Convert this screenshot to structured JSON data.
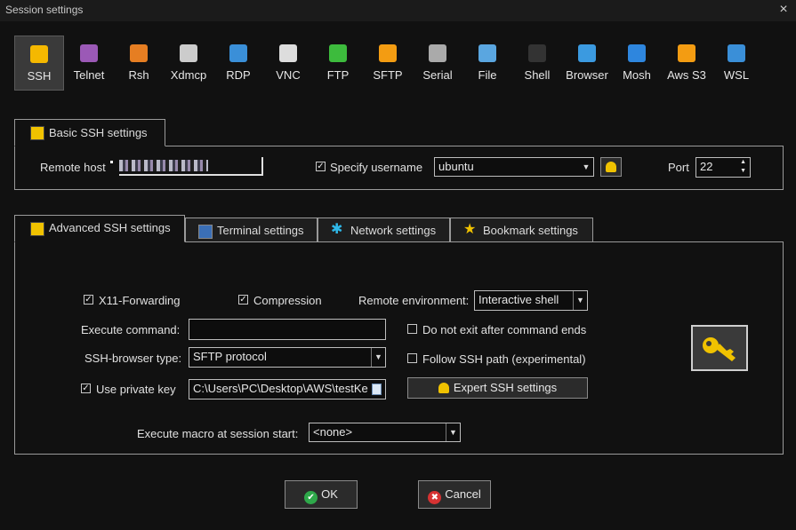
{
  "window": {
    "title": "Session settings",
    "close_icon": "×"
  },
  "protocols": [
    {
      "label": "SSH",
      "icon": "key-icon",
      "color": "#f5b800",
      "active": true
    },
    {
      "label": "Telnet",
      "icon": "telnet-icon",
      "color": "#9b59b6",
      "active": false
    },
    {
      "label": "Rsh",
      "icon": "rsh-icon",
      "color": "#e67e22",
      "active": false
    },
    {
      "label": "Xdmcp",
      "icon": "xdmcp-icon",
      "color": "#cccccc",
      "active": false
    },
    {
      "label": "RDP",
      "icon": "rdp-icon",
      "color": "#3a8fd8",
      "active": false
    },
    {
      "label": "VNC",
      "icon": "vnc-icon",
      "color": "#dddddd",
      "active": false
    },
    {
      "label": "FTP",
      "icon": "ftp-icon",
      "color": "#3dbb3d",
      "active": false
    },
    {
      "label": "SFTP",
      "icon": "sftp-icon",
      "color": "#f39c12",
      "active": false
    },
    {
      "label": "Serial",
      "icon": "serial-icon",
      "color": "#aaaaaa",
      "active": false
    },
    {
      "label": "File",
      "icon": "file-icon",
      "color": "#5aa6e0",
      "active": false
    },
    {
      "label": "Shell",
      "icon": "shell-icon",
      "color": "#333333",
      "active": false
    },
    {
      "label": "Browser",
      "icon": "globe-icon",
      "color": "#3b9ae0",
      "active": false
    },
    {
      "label": "Mosh",
      "icon": "mosh-icon",
      "color": "#2e86de",
      "active": false
    },
    {
      "label": "Aws S3",
      "icon": "aws-icon",
      "color": "#f39c12",
      "active": false
    },
    {
      "label": "WSL",
      "icon": "wsl-icon",
      "color": "#3a8fd8",
      "active": false
    }
  ],
  "basic": {
    "tab_label": "Basic SSH settings",
    "remote_host_label": "Remote host",
    "specify_username_label": "Specify username",
    "specify_username_checked": true,
    "username": "ubuntu",
    "port_label": "Port",
    "port": "22"
  },
  "tabs": [
    {
      "label": "Advanced SSH settings",
      "icon": "key-icon"
    },
    {
      "label": "Terminal settings",
      "icon": "terminal-icon"
    },
    {
      "label": "Network settings",
      "icon": "network-icon"
    },
    {
      "label": "Bookmark settings",
      "icon": "star-icon"
    }
  ],
  "advanced": {
    "x11_label": "X11-Forwarding",
    "compression_label": "Compression",
    "remote_env_label": "Remote environment:",
    "remote_env_value": "Interactive shell",
    "execute_command_label": "Execute command:",
    "execute_command_value": "",
    "do_not_exit_label": "Do not exit after command ends",
    "ssh_browser_label": "SSH-browser type:",
    "ssh_browser_value": "SFTP protocol",
    "follow_path_label": "Follow SSH path (experimental)",
    "private_key_label": "Use private key",
    "private_key_value": "C:\\Users\\PC\\Desktop\\AWS\\testKe",
    "expert_button": "Expert SSH settings",
    "macro_label": "Execute macro at session start:",
    "macro_value": "<none>"
  },
  "buttons": {
    "ok": "OK",
    "cancel": "Cancel"
  },
  "check_mark": "✓",
  "dd_arrow": "▼",
  "spin_up": "▲",
  "spin_down": "▼"
}
